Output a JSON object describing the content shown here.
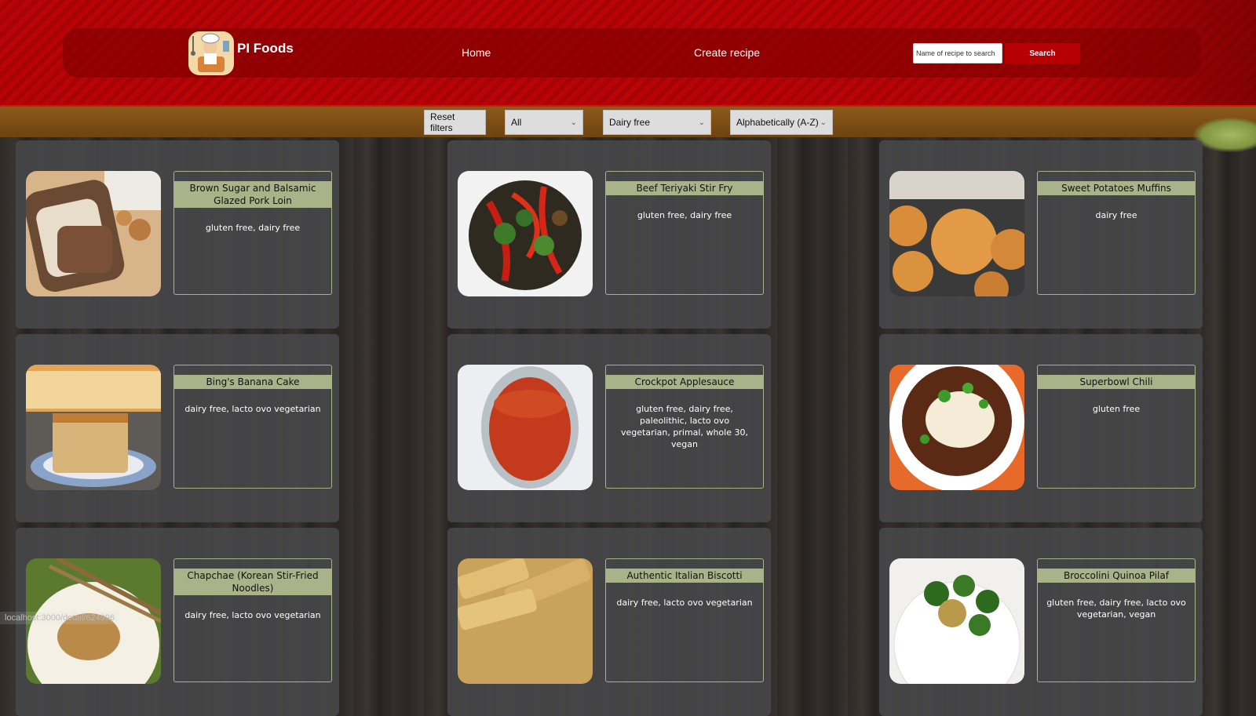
{
  "header": {
    "logo_text": "PI Foods",
    "nav": {
      "home": "Home",
      "create": "Create recipe"
    },
    "search": {
      "placeholder": "Name of recipe to search",
      "button": "Search"
    }
  },
  "filters": {
    "reset": "Reset filters",
    "source_selected": "All",
    "diet_selected": "Dairy free",
    "order_selected": "Alphabetically (A-Z)"
  },
  "cards": [
    {
      "title": "Brown Sugar and Balsamic Glazed Pork Loin",
      "diets": "gluten free, dairy free",
      "image": "pork-loin"
    },
    {
      "title": "Beef Teriyaki Stir Fry",
      "diets": "gluten free, dairy free",
      "image": "stir-fry"
    },
    {
      "title": "Sweet Potatoes Muffins",
      "diets": "dairy free",
      "image": "muffins"
    },
    {
      "title": "Bing's Banana Cake",
      "diets": "dairy free, lacto ovo vegetarian",
      "image": "banana-cake"
    },
    {
      "title": "Crockpot Applesauce",
      "diets": "gluten free, dairy free, paleolithic, lacto ovo vegetarian, primal, whole 30, vegan",
      "image": "applesauce"
    },
    {
      "title": "Superbowl Chili",
      "diets": "gluten free",
      "image": "chili"
    },
    {
      "title": "Chapchae (Korean Stir-Fried Noodles)",
      "diets": "dairy free, lacto ovo vegetarian",
      "image": "chapchae"
    },
    {
      "title": "Authentic Italian Biscotti",
      "diets": "dairy free, lacto ovo vegetarian",
      "image": "biscotti"
    },
    {
      "title": "Broccolini Quinoa Pilaf",
      "diets": "gluten free, dairy free, lacto ovo vegetarian, vegan",
      "image": "quinoa-pilaf"
    }
  ],
  "status_url": "localhost:3000/detail/624996"
}
